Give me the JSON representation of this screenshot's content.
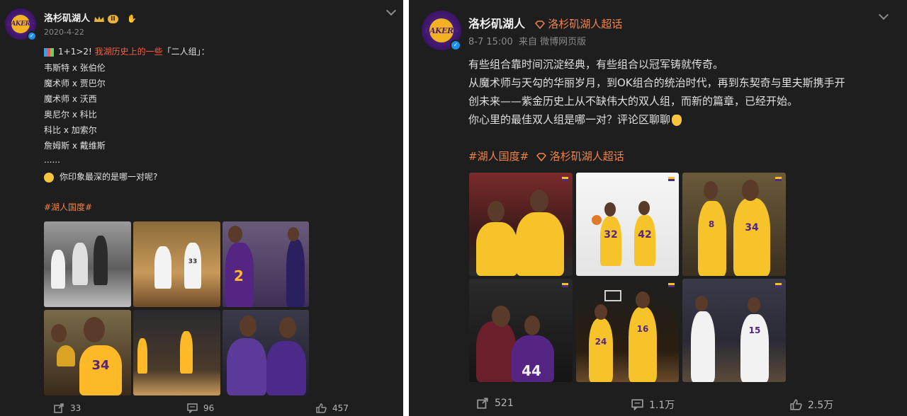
{
  "left_post": {
    "username": "洛杉矶湖人",
    "level_badge": "II",
    "date": "2020-4-22",
    "intro_prefix": "1+1>2! ",
    "intro_highlight": "我湖历史上的一些",
    "intro_suffix": "「二人组」：",
    "pairs": [
      "韦斯特 x 张伯伦",
      "魔术师 x 贾巴尔",
      "魔术师 x 沃西",
      "奥尼尔 x 科比",
      "科比 x 加索尔",
      "詹姆斯 x 戴维斯"
    ],
    "ellipsis": "......",
    "question": "你印象最深的是哪一对呢?",
    "hashtag": "#湖人国度#",
    "photo_jerseys": [
      "",
      "33",
      "2",
      "",
      "34",
      "",
      "",
      ""
    ],
    "reposts": "33",
    "comments": "96",
    "likes": "457"
  },
  "right_post": {
    "username": "洛杉矶湖人",
    "supertopic": "洛杉矶湖人超话",
    "time": "8-7 15:00",
    "source": "来自 微博网页版",
    "lines": [
      "有些组合靠时间沉淀经典，有些组合以冠军铸就传奇。",
      "从魔术师与天勾的华丽岁月，到OK组合的统治时代，再到东契奇与里夫斯携手开",
      "创未来——紫金历史上从不缺伟大的双人组，而新的篇章，已经开始。",
      "你心里的最佳双人组是哪一对？评论区聊聊"
    ],
    "hashtag": "#湖人国度#",
    "supertopic_tag": "洛杉矶湖人超话",
    "photo_jerseys": [
      "",
      "32",
      "42",
      "8",
      "34",
      "44",
      "24",
      "16",
      "15"
    ],
    "reposts": "521",
    "comments": "1.1万",
    "likes": "2.5万"
  },
  "avatar_text": "LAKERS",
  "icons": [
    "lakers-logo-icon",
    "verified-icon",
    "crown-icon",
    "chevron-down-icon",
    "repost-icon",
    "comment-icon",
    "like-icon",
    "thinking-emoji-icon",
    "point-down-emoji-icon",
    "supertopic-icon"
  ],
  "colors": {
    "background": "#1e1e1e",
    "accent": "#f0834a",
    "highlight": "#ff5a3c",
    "lakers_purple": "#552583",
    "lakers_gold": "#fdb927"
  }
}
